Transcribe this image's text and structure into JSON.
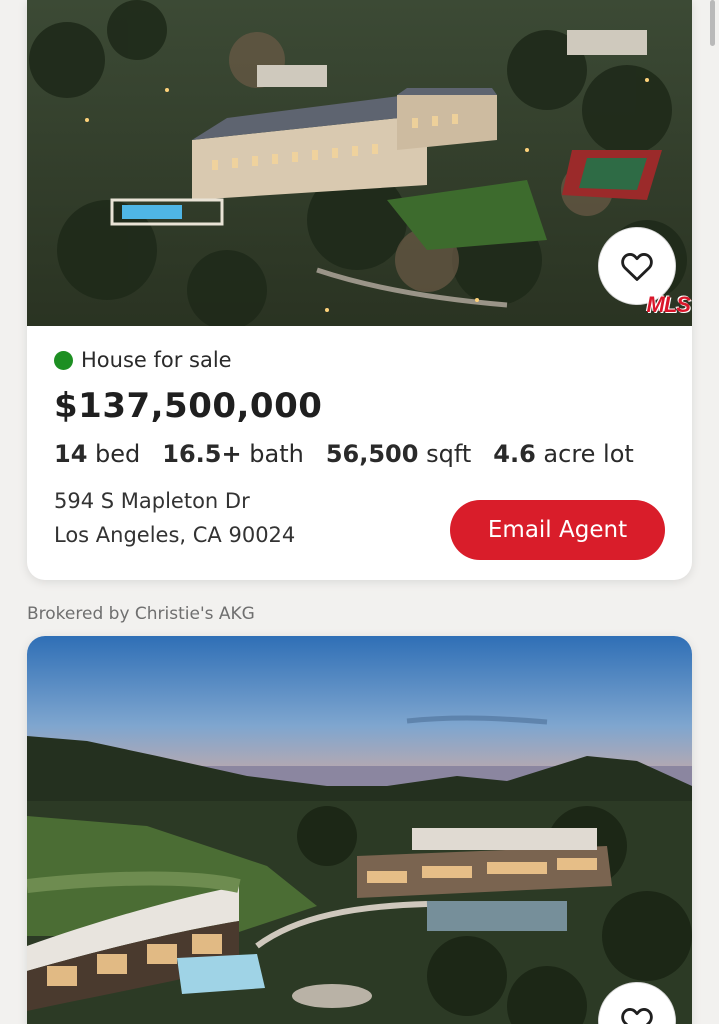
{
  "listing1": {
    "status": "House for sale",
    "status_color": "#1d8f22",
    "price": "$137,500,000",
    "beds_value": "14",
    "beds_label": "bed",
    "baths_value": "16.5+",
    "baths_label": "bath",
    "sqft_value": "56,500",
    "sqft_label": "sqft",
    "lot_value": "4.6",
    "lot_label": "acre lot",
    "address_line1": "594 S Mapleton Dr",
    "address_line2": "Los Angeles, CA 90024",
    "cta_label": "Email Agent",
    "mls_badge": "MLS",
    "favorite_icon": "heart-icon"
  },
  "listing2": {
    "broker": "Brokered by Christie's AKG",
    "favorite_icon": "heart-icon"
  },
  "colors": {
    "accent": "#d91d2a",
    "background": "#f2f1ef"
  }
}
